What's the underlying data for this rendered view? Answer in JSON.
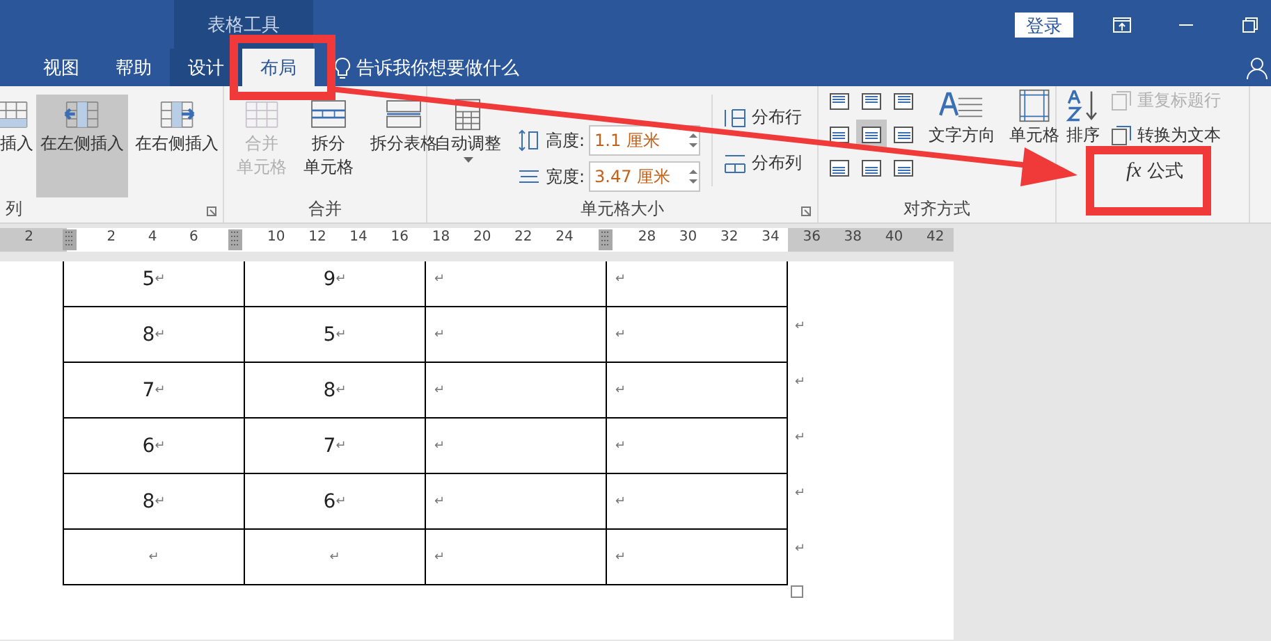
{
  "title_bar": {
    "context_group": "表格工具",
    "login_button": "登录"
  },
  "tabs": [
    {
      "label": "视图",
      "selected": false,
      "contextual": false
    },
    {
      "label": "帮助",
      "selected": false,
      "contextual": false
    },
    {
      "label": "设计",
      "selected": false,
      "contextual": true
    },
    {
      "label": "布局",
      "selected": true,
      "contextual": true
    }
  ],
  "tell_me": "告诉我你想要做什么",
  "ribbon": {
    "rows_columns": {
      "label": "列",
      "launcher": true,
      "buttons": [
        {
          "lines": [
            "插入"
          ],
          "selected": false
        },
        {
          "lines": [
            "在左侧插入"
          ],
          "selected": true
        },
        {
          "lines": [
            "在右侧插入"
          ],
          "selected": false
        }
      ]
    },
    "merge": {
      "label": "合并",
      "buttons": [
        {
          "lines": [
            "合并",
            "单元格"
          ],
          "disabled": true
        },
        {
          "lines": [
            "拆分",
            "单元格"
          ],
          "disabled": false
        },
        {
          "lines": [
            "拆分表格"
          ],
          "disabled": false
        }
      ]
    },
    "cell_size": {
      "label": "单元格大小",
      "launcher": true,
      "autofit": {
        "label": "自动调整"
      },
      "fields": [
        {
          "kind": "height",
          "label": "高度:",
          "value": "1.1 厘米"
        },
        {
          "kind": "width",
          "label": "宽度:",
          "value": "3.47 厘米"
        }
      ],
      "distribute": [
        {
          "kind": "rows",
          "label": "分布行"
        },
        {
          "kind": "columns",
          "label": "分布列"
        }
      ]
    },
    "alignment": {
      "label": "对齐方式",
      "cells": [
        {
          "selected": false
        },
        {
          "selected": false
        },
        {
          "selected": false
        },
        {
          "selected": false
        },
        {
          "selected": true
        },
        {
          "selected": false
        },
        {
          "selected": false
        },
        {
          "selected": false
        },
        {
          "selected": false
        }
      ],
      "buttons": [
        {
          "lines": [
            "文字方向"
          ]
        },
        {
          "lines": [
            "单元格"
          ]
        }
      ]
    },
    "data": {
      "sort": {
        "lines": [
          "排序"
        ]
      },
      "buttons": [
        {
          "kind": "repeat-header",
          "label": "重复标题行",
          "disabled": true
        },
        {
          "kind": "convert",
          "label": "转换为文本",
          "disabled": false
        },
        {
          "kind": "formula",
          "symbol": "fx",
          "label": "公式",
          "disabled": false
        }
      ]
    }
  },
  "ruler": [
    {
      "kind": "number",
      "text": "2"
    },
    {
      "kind": "marker"
    },
    {
      "kind": "number",
      "text": "2"
    },
    {
      "kind": "number",
      "text": "4"
    },
    {
      "kind": "number",
      "text": "6"
    },
    {
      "kind": "marker"
    },
    {
      "kind": "number",
      "text": "10"
    },
    {
      "kind": "number",
      "text": "12"
    },
    {
      "kind": "number",
      "text": "14"
    },
    {
      "kind": "number",
      "text": "16"
    },
    {
      "kind": "number",
      "text": "18"
    },
    {
      "kind": "number",
      "text": "20"
    },
    {
      "kind": "number",
      "text": "22"
    },
    {
      "kind": "number",
      "text": "24"
    },
    {
      "kind": "marker"
    },
    {
      "kind": "number",
      "text": "28"
    },
    {
      "kind": "number",
      "text": "30"
    },
    {
      "kind": "number",
      "text": "32"
    },
    {
      "kind": "number",
      "text": "34"
    },
    {
      "kind": "number",
      "text": "36"
    },
    {
      "kind": "number",
      "text": "38"
    },
    {
      "kind": "number",
      "text": "40"
    },
    {
      "kind": "number",
      "text": "42"
    }
  ],
  "table": {
    "rows": [
      {
        "cells": [
          {
            "text": "5",
            "mark": "↵"
          },
          {
            "text": "9",
            "mark": "↵"
          },
          {
            "mark": "↵"
          },
          {
            "mark": "↵"
          }
        ]
      },
      {
        "cells": [
          {
            "text": "8",
            "mark": "↵"
          },
          {
            "text": "5",
            "mark": "↵"
          },
          {
            "mark": "↵"
          },
          {
            "mark": "↵"
          }
        ],
        "end_mark": "↵"
      },
      {
        "cells": [
          {
            "text": "7",
            "mark": "↵"
          },
          {
            "text": "8",
            "mark": "↵"
          },
          {
            "mark": "↵"
          },
          {
            "mark": "↵"
          }
        ],
        "end_mark": "↵"
      },
      {
        "cells": [
          {
            "text": "6",
            "mark": "↵"
          },
          {
            "text": "7",
            "mark": "↵"
          },
          {
            "mark": "↵"
          },
          {
            "mark": "↵"
          }
        ],
        "end_mark": "↵"
      },
      {
        "cells": [
          {
            "text": "8",
            "mark": "↵"
          },
          {
            "text": "6",
            "mark": "↵"
          },
          {
            "mark": "↵"
          },
          {
            "mark": "↵"
          }
        ],
        "end_mark": "↵"
      },
      {
        "cells": [
          {
            "mark": "↵"
          },
          {
            "mark": "↵"
          },
          {
            "mark": "↵"
          },
          {
            "mark": "↵"
          }
        ],
        "end_mark": "↵"
      }
    ]
  }
}
